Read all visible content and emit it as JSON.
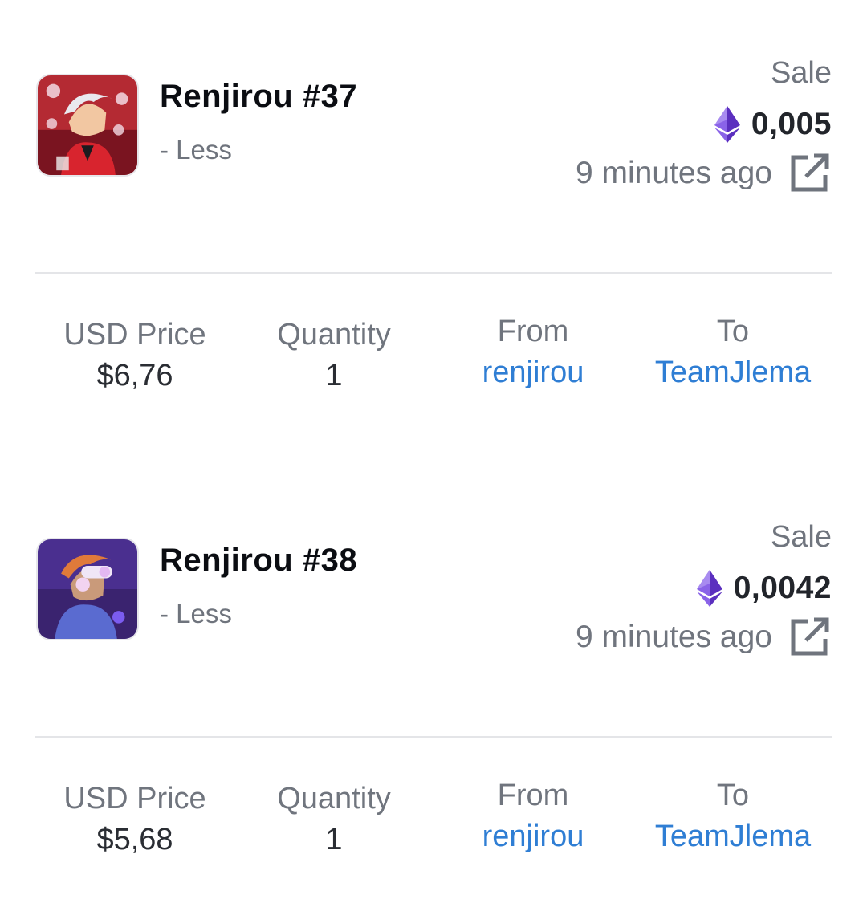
{
  "colors": {
    "link": "#2f7ed4",
    "muted_text": "#70757e",
    "title_text": "#0b0d12",
    "eth_purple": "#7b4fd6",
    "divider": "#e4e5e8"
  },
  "items": [
    {
      "title": "Renjirou #37",
      "toggle_label": "- Less",
      "event_type": "Sale",
      "currency_icon": "ethereum-icon",
      "price": "0,005",
      "time": "9 minutes ago",
      "external_link_icon": "external-link-icon",
      "details": {
        "usd_price_label": "USD Price",
        "usd_price": "$6,76",
        "quantity_label": "Quantity",
        "quantity": "1",
        "from_label": "From",
        "from": "renjirou",
        "to_label": "To",
        "to": "TeamJlema"
      }
    },
    {
      "title": "Renjirou #38",
      "toggle_label": "- Less",
      "event_type": "Sale",
      "currency_icon": "ethereum-icon",
      "price": "0,0042",
      "time": "9 minutes ago",
      "external_link_icon": "external-link-icon",
      "details": {
        "usd_price_label": "USD Price",
        "usd_price": "$5,68",
        "quantity_label": "Quantity",
        "quantity": "1",
        "from_label": "From",
        "from": "renjirou",
        "to_label": "To",
        "to": "TeamJlema"
      }
    }
  ]
}
